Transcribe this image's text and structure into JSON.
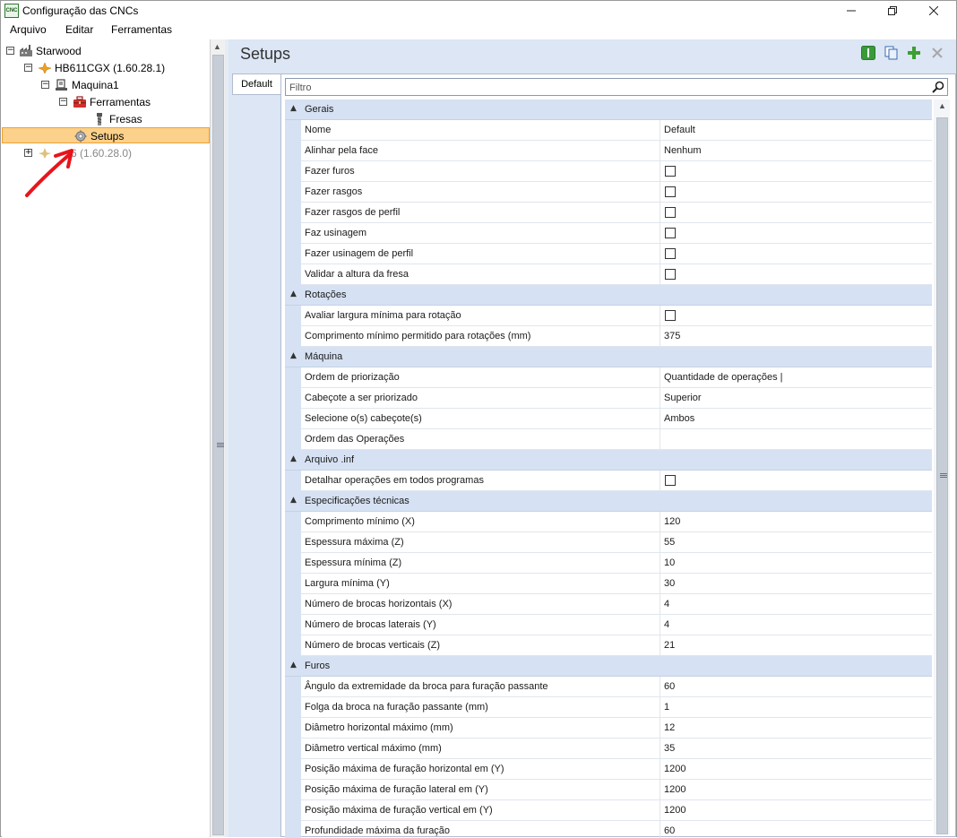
{
  "window": {
    "title": "Configuração das CNCs",
    "app_icon_label": "CNC",
    "minimize_icon": "minimize-icon",
    "restore_icon": "restore-icon",
    "close_icon": "close-icon"
  },
  "menu": {
    "items": [
      "Arquivo",
      "Editar",
      "Ferramentas"
    ]
  },
  "tree": {
    "root": "Starwood",
    "cnc": "HB611CGX (1.60.28.1)",
    "machine": "Maquina1",
    "tools": "Ferramentas",
    "mills": "Fresas",
    "setups": "Setups",
    "other_cnc": "6 (1.60.28.0)"
  },
  "pane": {
    "title": "Setups",
    "tab": "Default",
    "filter_placeholder": "Filtro"
  },
  "grid": {
    "categories": [
      {
        "label": "Gerais",
        "props": [
          {
            "name": "Nome",
            "value": "Default"
          },
          {
            "name": "Alinhar pela face",
            "value": "Nenhum"
          },
          {
            "name": "Fazer furos",
            "checkbox": true
          },
          {
            "name": "Fazer rasgos",
            "checkbox": true
          },
          {
            "name": "Fazer rasgos de perfil",
            "checkbox": true
          },
          {
            "name": "Faz usinagem",
            "checkbox": true
          },
          {
            "name": "Fazer usinagem de perfil",
            "checkbox": true
          },
          {
            "name": "Validar a altura da fresa",
            "checkbox": true
          }
        ]
      },
      {
        "label": "Rotações",
        "props": [
          {
            "name": "Avaliar largura mínima para rotação",
            "checkbox": true
          },
          {
            "name": "Comprimento mínimo permitido para rotações (mm)",
            "value": "375"
          }
        ]
      },
      {
        "label": "Máquina",
        "props": [
          {
            "name": "Ordem de priorização",
            "value": "Quantidade de operações |"
          },
          {
            "name": "Cabeçote a ser priorizado",
            "value": "Superior"
          },
          {
            "name": "Selecione o(s) cabeçote(s)",
            "value": "Ambos"
          },
          {
            "name": "Ordem das Operações",
            "value": ""
          }
        ]
      },
      {
        "label": "Arquivo .inf",
        "props": [
          {
            "name": "Detalhar operações em todos programas",
            "checkbox": true
          }
        ]
      },
      {
        "label": "Especificações técnicas",
        "props": [
          {
            "name": "Comprimento mínimo (X)",
            "value": "120"
          },
          {
            "name": "Espessura máxima (Z)",
            "value": "55"
          },
          {
            "name": "Espessura mínima (Z)",
            "value": "10"
          },
          {
            "name": "Largura mínima (Y)",
            "value": "30"
          },
          {
            "name": "Número de brocas horizontais (X)",
            "value": "4"
          },
          {
            "name": "Número de brocas laterais (Y)",
            "value": "4"
          },
          {
            "name": "Número de brocas verticais (Z)",
            "value": "21"
          }
        ]
      },
      {
        "label": "Furos",
        "props": [
          {
            "name": "Ângulo da extremidade da broca para furação passante",
            "value": "60"
          },
          {
            "name": "Folga da broca na furação passante (mm)",
            "value": "1"
          },
          {
            "name": "Diâmetro horizontal máximo (mm)",
            "value": "12"
          },
          {
            "name": "Diâmetro vertical máximo (mm)",
            "value": "35"
          },
          {
            "name": "Posição máxima de furação horizontal em (Y)",
            "value": "1200"
          },
          {
            "name": "Posição máxima de furação lateral em (Y)",
            "value": "1200"
          },
          {
            "name": "Posição máxima de furação vertical em (Y)",
            "value": "1200"
          },
          {
            "name": "Profundidade máxima da furação",
            "value": "60"
          }
        ]
      }
    ]
  },
  "colors": {
    "category_bg": "#d6e2f3",
    "selection": "#fbd18b",
    "pane_bg": "#dce6f4",
    "annotation": "#e8141c"
  }
}
